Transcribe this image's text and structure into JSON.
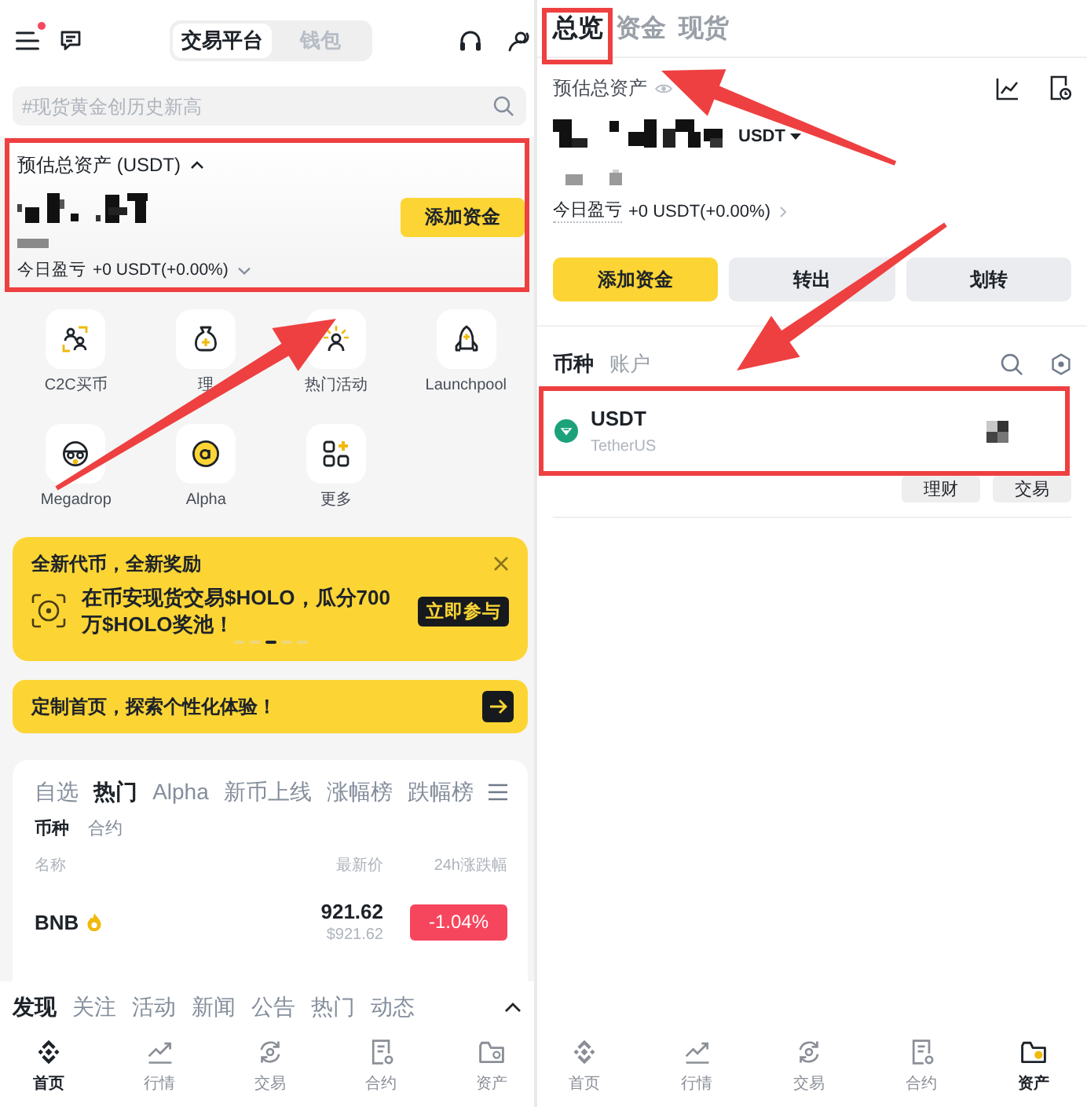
{
  "home": {
    "top_bar": {
      "menu_badge": true,
      "segments": [
        {
          "label": "交易平台",
          "selected": true
        },
        {
          "label": "钱包",
          "selected": false
        }
      ]
    },
    "search": {
      "placeholder": "#现货黄金创历史新高"
    },
    "asset_card": {
      "highlighted": true,
      "title": "预估总资产 (USDT)",
      "expanded": true,
      "button": "添加资金",
      "pnl_label": "今日盈亏",
      "pnl_value": "+0 USDT(+0.00%)"
    },
    "shortcuts": [
      {
        "label": "C2C买币"
      },
      {
        "label": "理"
      },
      {
        "label": "热门活动"
      },
      {
        "label": "Launchpool"
      },
      {
        "label": "Megadrop"
      },
      {
        "label": "Alpha"
      },
      {
        "label": "更多"
      }
    ],
    "promo": {
      "title": "全新代币，全新奖励",
      "headline": "在币安现货交易$HOLO，瓜分700万$HOLO奖池！",
      "button": "立即参与",
      "pages": [
        {
          "selected": false
        },
        {
          "selected": false
        },
        {
          "selected": true
        },
        {
          "selected": false
        },
        {
          "selected": false
        }
      ]
    },
    "customize": {
      "text": "定制首页，探索个性化体验！"
    },
    "market": {
      "tabs": [
        {
          "label": "自选",
          "selected": false
        },
        {
          "label": "热门",
          "selected": true
        },
        {
          "label": "Alpha",
          "selected": false
        },
        {
          "label": "新币上线",
          "selected": false
        },
        {
          "label": "涨幅榜",
          "selected": false
        },
        {
          "label": "跌幅榜",
          "selected": false
        }
      ],
      "subtabs": [
        {
          "label": "币种",
          "selected": true
        },
        {
          "label": "合约",
          "selected": false
        }
      ],
      "columns": [
        "名称",
        "最新价",
        "24h涨跌幅"
      ],
      "rows": [
        {
          "symbol": "BNB",
          "hot": true,
          "price": "921.62",
          "price_usd": "$921.62",
          "change": "-1.04%",
          "negative": true
        }
      ]
    },
    "feed_tabs": [
      {
        "label": "发现",
        "selected": true
      },
      {
        "label": "关注",
        "selected": false
      },
      {
        "label": "活动",
        "selected": false
      },
      {
        "label": "新闻",
        "selected": false
      },
      {
        "label": "公告",
        "selected": false
      },
      {
        "label": "热门",
        "selected": false
      },
      {
        "label": "动态",
        "selected": false
      }
    ],
    "nav": [
      {
        "label": "首页",
        "selected": true
      },
      {
        "label": "行情",
        "selected": false
      },
      {
        "label": "交易",
        "selected": false
      },
      {
        "label": "合约",
        "selected": false
      },
      {
        "label": "资产",
        "selected": false
      }
    ]
  },
  "assets": {
    "tabs": [
      {
        "label": "总览",
        "selected": true,
        "highlighted": true
      },
      {
        "label": "资金",
        "selected": false,
        "highlighted": false
      },
      {
        "label": "现货",
        "selected": false,
        "highlighted": false
      }
    ],
    "title": "预估总资产",
    "currency": "USDT",
    "pnl_label": "今日盈亏",
    "pnl_value": "+0 USDT(+0.00%)",
    "actions": [
      {
        "label": "添加资金",
        "kind": "primary"
      },
      {
        "label": "转出",
        "kind": "secondary"
      },
      {
        "label": "划转",
        "kind": "secondary"
      }
    ],
    "list_tabs": [
      {
        "label": "币种",
        "selected": true
      },
      {
        "label": "账户",
        "selected": false
      }
    ],
    "coins": [
      {
        "symbol": "USDT",
        "name": "TetherUS",
        "highlighted": true,
        "actions": [
          "理财",
          "交易"
        ]
      }
    ],
    "nav": [
      {
        "label": "首页",
        "selected": false
      },
      {
        "label": "行情",
        "selected": false
      },
      {
        "label": "交易",
        "selected": false
      },
      {
        "label": "合约",
        "selected": false
      },
      {
        "label": "资产",
        "selected": true
      }
    ]
  }
}
